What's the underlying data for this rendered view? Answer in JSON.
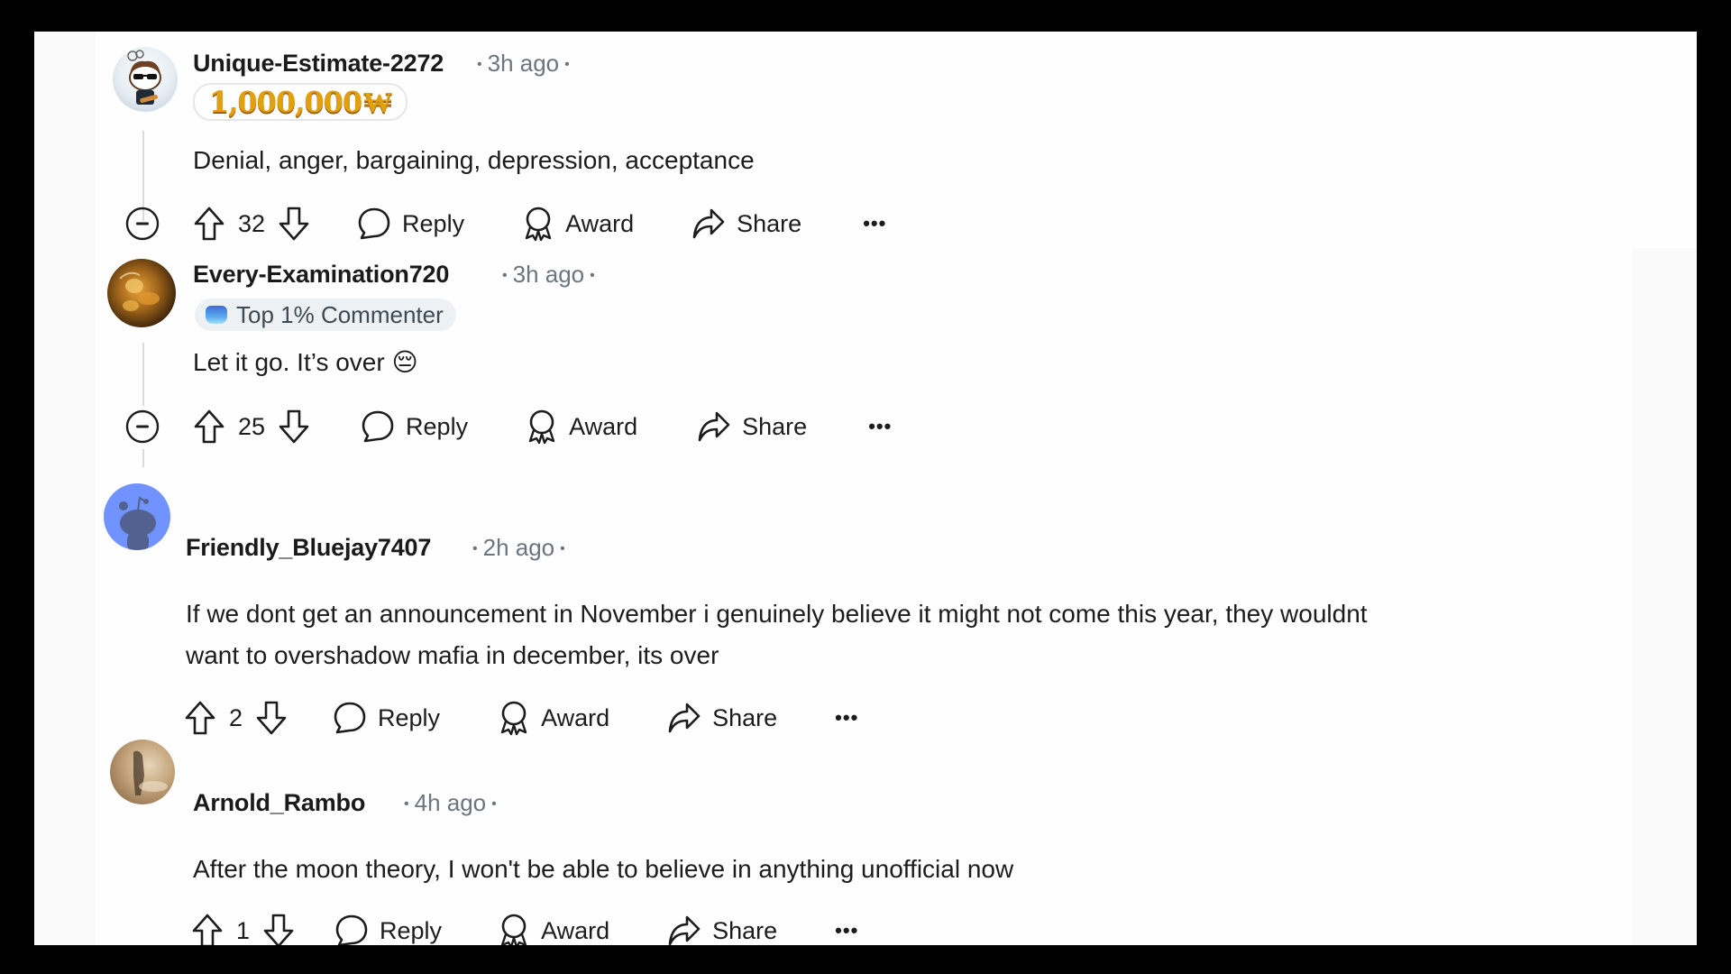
{
  "comments": [
    {
      "username": "Unique-Estimate-2272",
      "time": "3h ago",
      "badge": "1,000,000",
      "badge_suffix": "₩",
      "badge_type": "karma-gold",
      "body": [
        "Denial, anger, bargaining, depression, acceptance"
      ],
      "votes": "32",
      "collapsible": true,
      "avatar_colors": [
        "#e8eef3",
        "#5b3a24"
      ]
    },
    {
      "username": "Every-Examination720",
      "time": "3h ago",
      "badge": "Top 1% Commenter",
      "badge_type": "top-commenter",
      "body": [
        "Let it go. It’s over 😔"
      ],
      "votes": "25",
      "collapsible": true,
      "avatar_colors": [
        "#2a1a0a",
        "#d9962a"
      ]
    },
    {
      "username": "Friendly_Bluejay7407",
      "time": "2h ago",
      "body": [
        "If we dont get an announcement in November i genuinely believe it might not come this year, they wouldnt",
        "want to overshadow mafia in december, its over"
      ],
      "votes": "2",
      "collapsible": false,
      "avatar_colors": [
        "#7193ff",
        "#52618f"
      ]
    },
    {
      "username": "Arnold_Rambo",
      "time": "4h ago",
      "body": [
        "After the moon theory, I won't be able to believe in anything unofficial now"
      ],
      "votes": "1",
      "collapsible": false,
      "avatar_colors": [
        "#b99a72",
        "#4a3a28"
      ]
    }
  ],
  "actions": {
    "reply": "Reply",
    "award": "Award",
    "share": "Share",
    "more": "•••"
  },
  "icons": {
    "collapse": "minus-circle-icon",
    "upvote": "arrow-up-icon",
    "downvote": "arrow-down-icon",
    "reply": "speech-bubble-icon",
    "award": "award-ribbon-icon",
    "share": "share-arrow-icon",
    "more": "ellipsis-icon"
  },
  "colors": {
    "background": "#000000",
    "panel": "#fefefe",
    "text": "#1c1c1c",
    "meta": "#6a7580",
    "thread_line": "#d9dcde",
    "badge_gold": "#e0a010",
    "badge_top_bg": "#eef1f3"
  }
}
